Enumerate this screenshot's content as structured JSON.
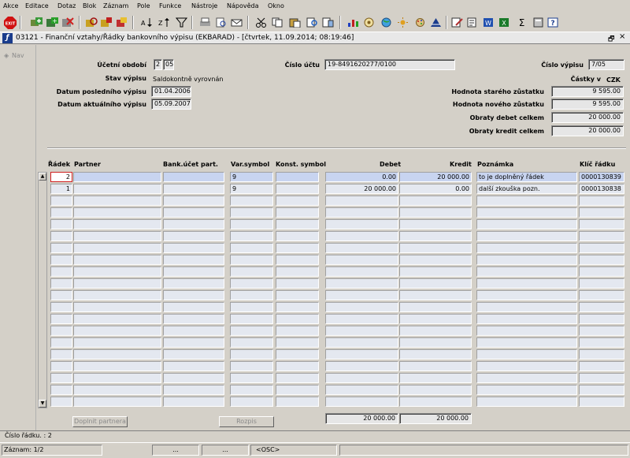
{
  "menu": {
    "items": [
      "Akce",
      "Editace",
      "Dotaz",
      "Blok",
      "Záznam",
      "Pole",
      "Funkce",
      "Nástroje",
      "Nápověda",
      "Okno"
    ]
  },
  "toolbar": {
    "exit_label": "EXIT",
    "icons": [
      "save-icon",
      "new-record-icon",
      "delete-record-icon",
      "clear-icon",
      "enter-query-icon",
      "execute-query-icon",
      "sort-icon",
      "filter-icon",
      "print-icon",
      "preview-icon",
      "attach-icon",
      "mail-icon",
      "cut-icon",
      "copy-icon",
      "paste-icon",
      "find-icon",
      "chart-icon",
      "globe-icon",
      "sun-icon",
      "alert-icon",
      "edit-icon",
      "export-icon",
      "excel-icon",
      "sum-icon",
      "calc-icon",
      "help-icon"
    ]
  },
  "window": {
    "title": "03121 - Finanční vztahy/Řádky bankovního výpisu (EKBARAD) - [čtvrtek, 11.09.2014; 08:19:46]",
    "restore_glyph": "🗗",
    "close_glyph": "×"
  },
  "nav": {
    "label": "Nav"
  },
  "header": {
    "ucetni_obdobi_label": "Účetní období",
    "ucetni_obdobi_1": "2",
    "ucetni_obdobi_2": "05",
    "cislo_uctu_label": "Číslo účtu",
    "cislo_uctu": "19-8491620277/0100",
    "cislo_vypisu_label": "Číslo výpisu",
    "cislo_vypisu": "7/05",
    "stav_vypisu_label": "Stav výpisu",
    "stav_vypisu": "Saldokontně vyrovnán",
    "castky_v_label": "Částky v",
    "castky_v": "CZK",
    "datum_posledniho_label": "Datum posledního výpisu",
    "datum_posledniho": "01.04.2006",
    "datum_aktualniho_label": "Datum aktuálního výpisu",
    "datum_aktualniho": "05.09.2007",
    "hodnota_stareho_label": "Hodnota starého zůstatku",
    "hodnota_stareho": "9 595.00",
    "hodnota_noveho_label": "Hodnota nového zůstatku",
    "hodnota_noveho": "9 595.00",
    "obraty_debet_label": "Obraty debet celkem",
    "obraty_debet": "20 000.00",
    "obraty_kredit_label": "Obraty kredit celkem",
    "obraty_kredit": "20 000.00"
  },
  "table": {
    "columns": {
      "radek": "Řádek",
      "partner": "Partner",
      "bank": "Bank.účet part.",
      "var": "Var.symbol",
      "konst": "Konst. symbol",
      "debet": "Debet",
      "kredit": "Kredit",
      "poznamka": "Poznámka",
      "klic": "Klíč řádku"
    },
    "rows": [
      {
        "radek": "2",
        "partner": "",
        "bank": "",
        "var": "9",
        "konst": "",
        "debet": "0.00",
        "kredit": "20 000.00",
        "poznamka": "to je doplněný řádek",
        "klic": "0000130839"
      },
      {
        "radek": "1",
        "partner": "",
        "bank": "",
        "var": "9",
        "konst": "",
        "debet": "20 000.00",
        "kredit": "0.00",
        "poznamka": "další zkouška pozn.",
        "klic": "0000130838"
      }
    ],
    "total_debet": "20 000.00",
    "total_kredit": "20 000.00"
  },
  "buttons": {
    "doplnit_partnera": "Doplnit partnera",
    "rozpis": "Rozpis"
  },
  "status": {
    "cislo_radku": "Číslo řádku. : 2",
    "zaznam": "Záznam: 1/2",
    "seg2": "...",
    "osc": "<OSC>"
  }
}
